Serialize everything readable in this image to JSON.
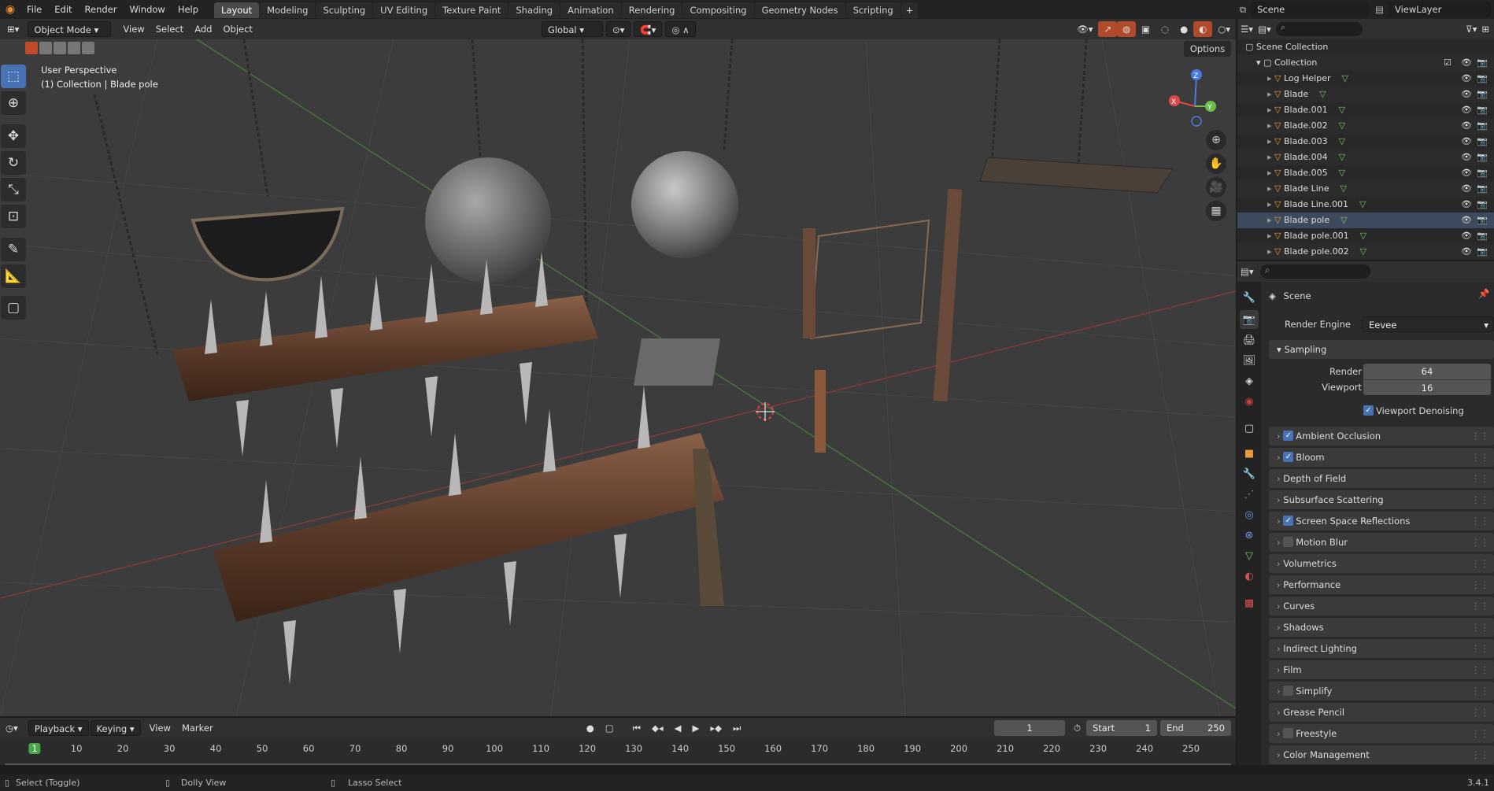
{
  "menus": [
    "File",
    "Edit",
    "Render",
    "Window",
    "Help"
  ],
  "workspaces": [
    "Layout",
    "Modeling",
    "Sculpting",
    "UV Editing",
    "Texture Paint",
    "Shading",
    "Animation",
    "Rendering",
    "Compositing",
    "Geometry Nodes",
    "Scripting"
  ],
  "active_workspace": "Layout",
  "scene_name": "Scene",
  "view_layer": "ViewLayer",
  "header3d": {
    "mode": "Object Mode",
    "menus": [
      "View",
      "Select",
      "Add",
      "Object"
    ],
    "transform_orientation": "Global",
    "options_label": "Options"
  },
  "viewport": {
    "perspective_label": "User Perspective",
    "collection_label": "(1) Collection | Blade pole"
  },
  "outliner": {
    "root": "Scene Collection",
    "collection": "Collection",
    "items": [
      "Log Helper",
      "Blade",
      "Blade.001",
      "Blade.002",
      "Blade.003",
      "Blade.004",
      "Blade.005",
      "Blade Line",
      "Blade Line.001",
      "Blade pole",
      "Blade pole.001",
      "Blade pole.002"
    ],
    "selected": "Blade pole"
  },
  "properties": {
    "context": "Scene",
    "render_engine_label": "Render Engine",
    "render_engine": "Eevee",
    "sampling_label": "Sampling",
    "render_label": "Render",
    "render_value": "64",
    "viewport_label": "Viewport",
    "viewport_value": "16",
    "viewport_denoising": "Viewport Denoising",
    "panels": [
      {
        "label": "Ambient Occlusion",
        "checkbox": true,
        "checked": true
      },
      {
        "label": "Bloom",
        "checkbox": true,
        "checked": true
      },
      {
        "label": "Depth of Field",
        "checkbox": false
      },
      {
        "label": "Subsurface Scattering",
        "checkbox": false
      },
      {
        "label": "Screen Space Reflections",
        "checkbox": true,
        "checked": true
      },
      {
        "label": "Motion Blur",
        "checkbox": true,
        "checked": false
      },
      {
        "label": "Volumetrics",
        "checkbox": false
      },
      {
        "label": "Performance",
        "checkbox": false
      },
      {
        "label": "Curves",
        "checkbox": false
      },
      {
        "label": "Shadows",
        "checkbox": false
      },
      {
        "label": "Indirect Lighting",
        "checkbox": false
      },
      {
        "label": "Film",
        "checkbox": false
      },
      {
        "label": "Simplify",
        "checkbox": true,
        "checked": false
      },
      {
        "label": "Grease Pencil",
        "checkbox": false
      },
      {
        "label": "Freestyle",
        "checkbox": true,
        "checked": false
      },
      {
        "label": "Color Management",
        "checkbox": false
      }
    ]
  },
  "timeline": {
    "menus": [
      "Playback",
      "Keying",
      "View",
      "Marker"
    ],
    "current_frame": "1",
    "start_label": "Start",
    "start": "1",
    "end_label": "End",
    "end": "250",
    "ticks": [
      "1",
      "10",
      "20",
      "30",
      "40",
      "50",
      "60",
      "70",
      "80",
      "90",
      "100",
      "110",
      "120",
      "130",
      "140",
      "150",
      "160",
      "170",
      "180",
      "190",
      "200",
      "210",
      "220",
      "230",
      "240",
      "250"
    ]
  },
  "status": {
    "left": "Select (Toggle)",
    "middle": "Dolly View",
    "right": "Lasso Select",
    "version": "3.4.1"
  },
  "colors": {
    "accent": "#4772b3",
    "active_frame": "#47a447",
    "object_icon": "#e89b3a",
    "mesh_icon": "#79c36a"
  }
}
